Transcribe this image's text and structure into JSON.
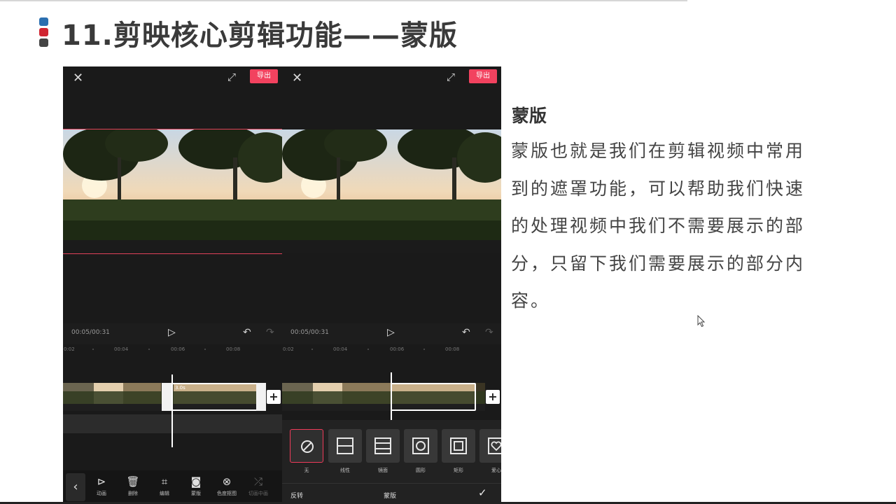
{
  "slide": {
    "title": "11.剪映核心剪辑功能——蒙版",
    "bullet_colors": [
      "#2b6fb0",
      "#d02531",
      "#444444"
    ],
    "accent": "#f2425f"
  },
  "left_phone": {
    "close_icon": "close-icon",
    "export_label": "导出",
    "time": "00:05/00:31",
    "ruler_ticks": [
      "0:02",
      "00:04",
      "00:06",
      "00:08"
    ],
    "clip_duration": "3.0s",
    "tools": [
      {
        "icon": "play-square-icon",
        "label": "动画"
      },
      {
        "icon": "trash-icon",
        "label": "删除"
      },
      {
        "icon": "crop-icon",
        "label": "编辑"
      },
      {
        "icon": "mask-icon",
        "label": "蒙版"
      },
      {
        "icon": "chroma-key-icon",
        "label": "色度抠图"
      },
      {
        "icon": "shuffle-icon",
        "label": "切画中画"
      }
    ]
  },
  "right_phone": {
    "export_label": "导出",
    "time": "00:05/00:31",
    "ruler_ticks": [
      "0:02",
      "00:04",
      "00:06",
      "00:08"
    ],
    "mask_options": [
      {
        "icon": "none-icon",
        "label": "无",
        "selected": true
      },
      {
        "icon": "linear-icon",
        "label": "线性"
      },
      {
        "icon": "mirror-icon",
        "label": "镜面"
      },
      {
        "icon": "circle-icon",
        "label": "圆形"
      },
      {
        "icon": "rectangle-icon",
        "label": "矩形"
      },
      {
        "icon": "heart-icon",
        "label": "爱心"
      }
    ],
    "invert_label": "反转",
    "panel_title": "蒙版",
    "confirm_icon": "check-icon"
  },
  "description": {
    "heading": "蒙版",
    "body": "蒙版也就是我们在剪辑视频中常用到的遮罩功能，可以帮助我们快速的处理视频中我们不需要展示的部分，只留下我们需要展示的部分内容。"
  }
}
